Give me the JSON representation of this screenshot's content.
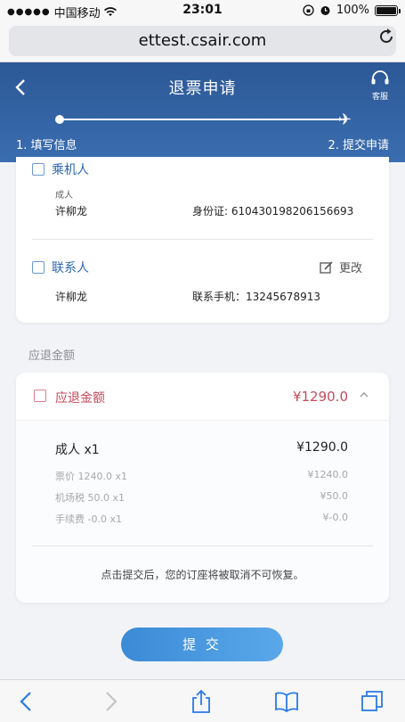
{
  "status_bar": {
    "carrier": "中国移动",
    "time": "23:01",
    "battery": "100%"
  },
  "browser": {
    "url": "ettest.csair.com"
  },
  "header": {
    "title": "退票申请",
    "service_label": "客服",
    "step1": "1. 填写信息",
    "step2": "2. 提交申请"
  },
  "passenger": {
    "section_label": "乘机人",
    "type": "成人",
    "name": "许柳龙",
    "id_text": "身份证: 610430198206156693"
  },
  "contact": {
    "section_label": "联系人",
    "edit_label": "更改",
    "name": "许柳龙",
    "phone_text": "联系手机：13245678913"
  },
  "refund": {
    "section_title": "应退金额",
    "label": "应退金额",
    "total": "¥1290.0",
    "pax_label": "成人 x1",
    "pax_total": "¥1290.0",
    "fees": [
      {
        "label": "票价 1240.0 x1",
        "value": "¥1240.0"
      },
      {
        "label": "机场税 50.0 x1",
        "value": "¥50.0"
      },
      {
        "label": "手续费 -0.0 x1",
        "value": "¥-0.0"
      }
    ],
    "note": "点击提交后，您的订座将被取消不可恢复。"
  },
  "submit_label": "提 交",
  "colors": {
    "header": "#2c5896",
    "accent_red": "#c44a5c",
    "link_blue": "#2d67b0",
    "button": "#4a9be0"
  }
}
